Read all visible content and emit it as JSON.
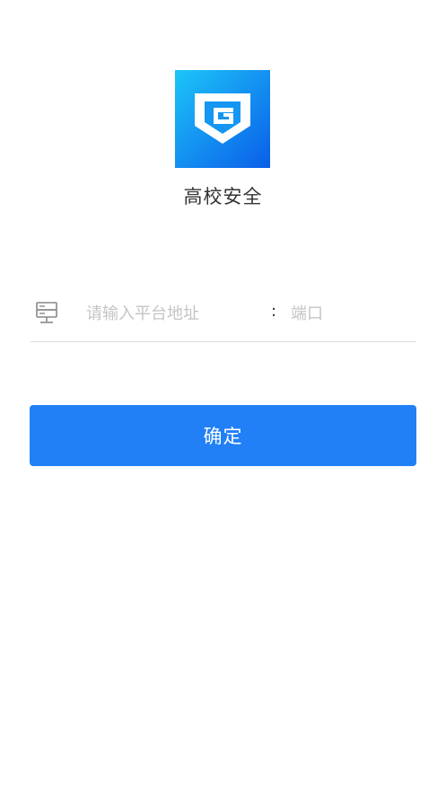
{
  "app": {
    "logo_icon": "shield-book-logo",
    "name": "高校安全"
  },
  "form": {
    "server_icon": "server-icon",
    "address": {
      "value": "",
      "placeholder": "请输入平台地址"
    },
    "separator": ":",
    "port": {
      "value": "",
      "placeholder": "端口"
    }
  },
  "actions": {
    "confirm_label": "确定"
  },
  "colors": {
    "primary": "#2180f6",
    "logo_gradient_start": "#1cc6f7",
    "logo_gradient_end": "#0a5ee8",
    "placeholder": "#c4c4c4",
    "divider": "#dcdcdc"
  }
}
